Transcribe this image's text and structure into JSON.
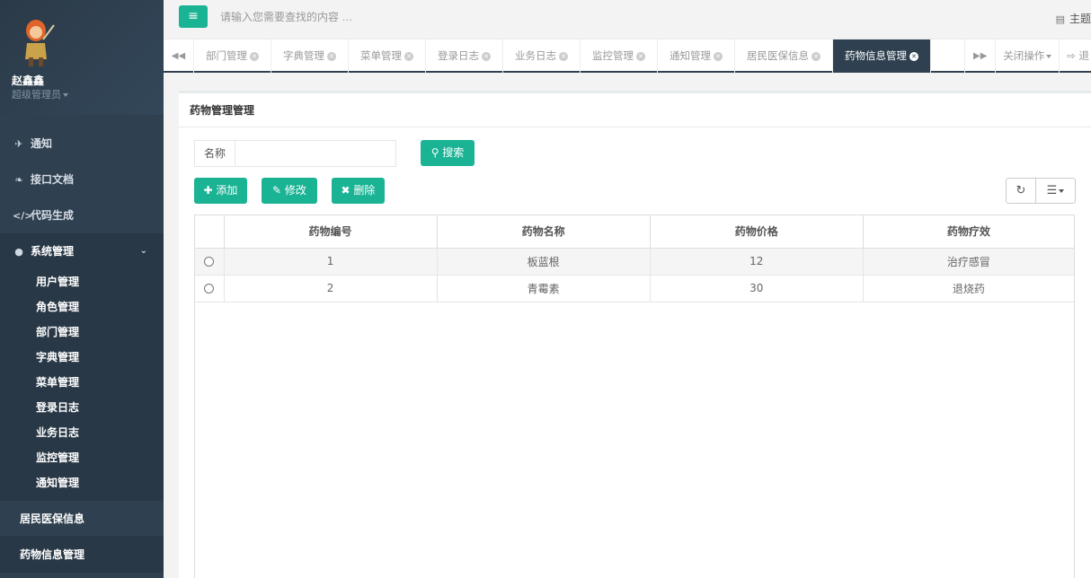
{
  "user": {
    "name": "赵鑫鑫",
    "role": "超级管理员"
  },
  "sidebar": {
    "items": [
      {
        "icon": "rocket-icon",
        "glyph": "✈",
        "label": "通知"
      },
      {
        "icon": "leaf-icon",
        "glyph": "❧",
        "label": "接口文档"
      },
      {
        "icon": "code-icon",
        "glyph": "</>",
        "label": "代码生成"
      }
    ],
    "system": {
      "icon": "user-icon",
      "glyph": "●",
      "label": "系统管理"
    },
    "sub_items": [
      "用户管理",
      "角色管理",
      "部门管理",
      "字典管理",
      "菜单管理",
      "登录日志",
      "业务日志",
      "监控管理",
      "通知管理"
    ],
    "extra": [
      "居民医保信息",
      "药物信息管理"
    ]
  },
  "topbar": {
    "search_placeholder": "请输入您需要查找的内容 …",
    "theme_label": "主题"
  },
  "tabs": [
    "部门管理",
    "字典管理",
    "菜单管理",
    "登录日志",
    "业务日志",
    "监控管理",
    "通知管理",
    "居民医保信息",
    "药物信息管理"
  ],
  "tab_actions": {
    "close_ops": "关闭操作",
    "exit": "退"
  },
  "panel": {
    "title": "药物管理管理",
    "name_label": "名称",
    "search_btn": "搜索",
    "add_btn": "添加",
    "edit_btn": "修改",
    "delete_btn": "删除"
  },
  "table": {
    "columns": [
      "药物编号",
      "药物名称",
      "药物价格",
      "药物疗效"
    ],
    "rows": [
      [
        "1",
        "板蓝根",
        "12",
        "治疗感冒"
      ],
      [
        "2",
        "青霉素",
        "30",
        "退烧药"
      ]
    ]
  },
  "colors": {
    "sidebar": "#2f4050",
    "accent": "#1ab394"
  }
}
